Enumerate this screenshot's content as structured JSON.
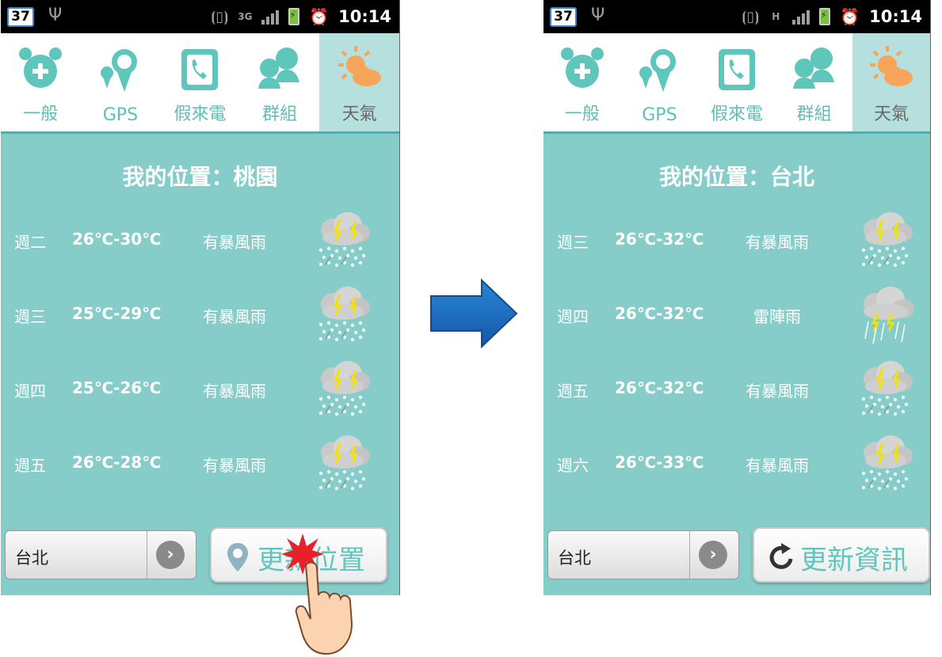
{
  "status_bar": {
    "notification_badge": "37",
    "time": "10:14",
    "network_left": "3G",
    "network_right": "H"
  },
  "tabs": [
    {
      "label": "一般",
      "icon": "alarm-clock-icon"
    },
    {
      "label": "GPS",
      "icon": "map-pin-alarm-icon"
    },
    {
      "label": "假來電",
      "icon": "phone-icon"
    },
    {
      "label": "群組",
      "icon": "people-icon"
    },
    {
      "label": "天氣",
      "icon": "weather-sun-cloud-icon"
    }
  ],
  "before": {
    "location_title": "我的位置：桃園",
    "forecast": [
      {
        "day": "週二",
        "temp": "26℃-30℃",
        "condition": "有暴風雨",
        "icon": "thunderstorm-icon"
      },
      {
        "day": "週三",
        "temp": "25℃-29℃",
        "condition": "有暴風雨",
        "icon": "thunderstorm-icon"
      },
      {
        "day": "週四",
        "temp": "25℃-26℃",
        "condition": "有暴風雨",
        "icon": "thunderstorm-icon"
      },
      {
        "day": "週五",
        "temp": "26℃-28℃",
        "condition": "有暴風雨",
        "icon": "thunderstorm-icon"
      }
    ],
    "city_select": "台北",
    "action_button": "更新位置",
    "action_icon": "location-pin-icon"
  },
  "after": {
    "location_title": "我的位置：台北",
    "forecast": [
      {
        "day": "週三",
        "temp": "26℃-32℃",
        "condition": "有暴風雨",
        "icon": "thunderstorm-icon"
      },
      {
        "day": "週四",
        "temp": "26℃-32℃",
        "condition": "雷陣雨",
        "icon": "thunder-shower-icon"
      },
      {
        "day": "週五",
        "temp": "26℃-32℃",
        "condition": "有暴風雨",
        "icon": "thunderstorm-icon"
      },
      {
        "day": "週六",
        "temp": "26℃-33℃",
        "condition": "有暴風雨",
        "icon": "thunderstorm-icon"
      }
    ],
    "city_select": "台北",
    "action_button": "更新資訊",
    "action_icon": "refresh-icon"
  },
  "colors": {
    "background": "#86cdc9",
    "tab_active": "#b6e0de",
    "accent": "#5fc6bc",
    "arrow": "#1f6fc3",
    "burst": "#e8202a"
  }
}
